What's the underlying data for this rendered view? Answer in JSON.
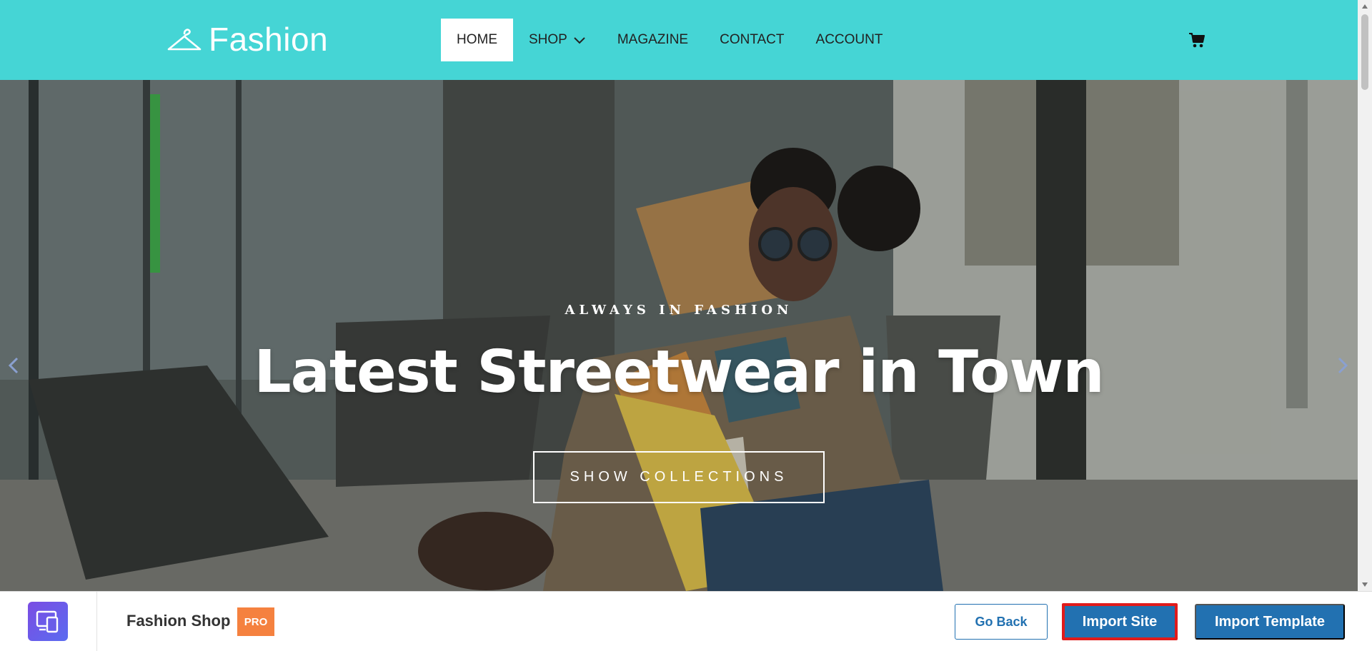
{
  "header": {
    "logo_text": "Fashion",
    "background_color": "#45d5d5",
    "nav": [
      {
        "label": "HOME",
        "active": true
      },
      {
        "label": "SHOP",
        "has_dropdown": true
      },
      {
        "label": "MAGAZINE"
      },
      {
        "label": "CONTACT"
      },
      {
        "label": "ACCOUNT"
      }
    ],
    "cart_icon": "cart-icon"
  },
  "hero": {
    "kicker": "ALWAYS IN FASHION",
    "title": "Latest Streetwear in Town",
    "button_label": "SHOW COLLECTIONS"
  },
  "import_bar": {
    "site_name": "Fashion Shop",
    "badge": "PRO",
    "go_back_label": "Go Back",
    "import_site_label": "Import Site",
    "import_template_label": "Import Template",
    "accent_color": "#2271b1",
    "badge_color": "#f5813f",
    "highlight_color": "#e11b1b"
  }
}
